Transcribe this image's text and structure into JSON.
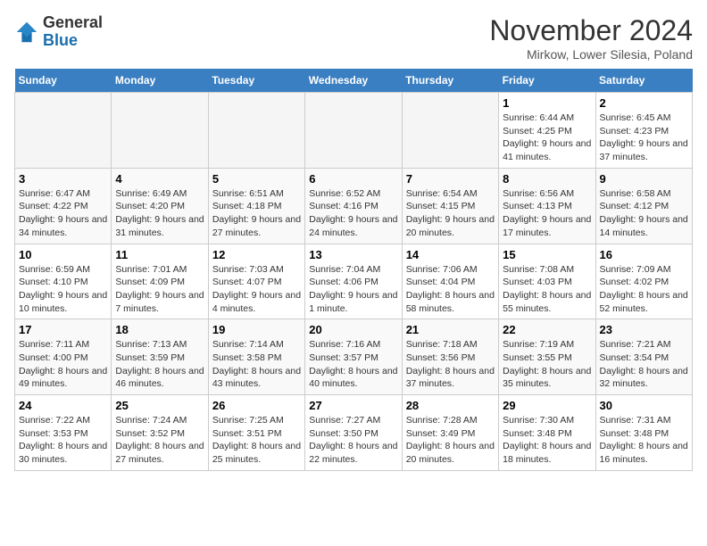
{
  "header": {
    "logo_general": "General",
    "logo_blue": "Blue",
    "month": "November 2024",
    "location": "Mirkow, Lower Silesia, Poland"
  },
  "days_of_week": [
    "Sunday",
    "Monday",
    "Tuesday",
    "Wednesday",
    "Thursday",
    "Friday",
    "Saturday"
  ],
  "weeks": [
    [
      {
        "day": "",
        "info": ""
      },
      {
        "day": "",
        "info": ""
      },
      {
        "day": "",
        "info": ""
      },
      {
        "day": "",
        "info": ""
      },
      {
        "day": "",
        "info": ""
      },
      {
        "day": "1",
        "info": "Sunrise: 6:44 AM\nSunset: 4:25 PM\nDaylight: 9 hours and 41 minutes."
      },
      {
        "day": "2",
        "info": "Sunrise: 6:45 AM\nSunset: 4:23 PM\nDaylight: 9 hours and 37 minutes."
      }
    ],
    [
      {
        "day": "3",
        "info": "Sunrise: 6:47 AM\nSunset: 4:22 PM\nDaylight: 9 hours and 34 minutes."
      },
      {
        "day": "4",
        "info": "Sunrise: 6:49 AM\nSunset: 4:20 PM\nDaylight: 9 hours and 31 minutes."
      },
      {
        "day": "5",
        "info": "Sunrise: 6:51 AM\nSunset: 4:18 PM\nDaylight: 9 hours and 27 minutes."
      },
      {
        "day": "6",
        "info": "Sunrise: 6:52 AM\nSunset: 4:16 PM\nDaylight: 9 hours and 24 minutes."
      },
      {
        "day": "7",
        "info": "Sunrise: 6:54 AM\nSunset: 4:15 PM\nDaylight: 9 hours and 20 minutes."
      },
      {
        "day": "8",
        "info": "Sunrise: 6:56 AM\nSunset: 4:13 PM\nDaylight: 9 hours and 17 minutes."
      },
      {
        "day": "9",
        "info": "Sunrise: 6:58 AM\nSunset: 4:12 PM\nDaylight: 9 hours and 14 minutes."
      }
    ],
    [
      {
        "day": "10",
        "info": "Sunrise: 6:59 AM\nSunset: 4:10 PM\nDaylight: 9 hours and 10 minutes."
      },
      {
        "day": "11",
        "info": "Sunrise: 7:01 AM\nSunset: 4:09 PM\nDaylight: 9 hours and 7 minutes."
      },
      {
        "day": "12",
        "info": "Sunrise: 7:03 AM\nSunset: 4:07 PM\nDaylight: 9 hours and 4 minutes."
      },
      {
        "day": "13",
        "info": "Sunrise: 7:04 AM\nSunset: 4:06 PM\nDaylight: 9 hours and 1 minute."
      },
      {
        "day": "14",
        "info": "Sunrise: 7:06 AM\nSunset: 4:04 PM\nDaylight: 8 hours and 58 minutes."
      },
      {
        "day": "15",
        "info": "Sunrise: 7:08 AM\nSunset: 4:03 PM\nDaylight: 8 hours and 55 minutes."
      },
      {
        "day": "16",
        "info": "Sunrise: 7:09 AM\nSunset: 4:02 PM\nDaylight: 8 hours and 52 minutes."
      }
    ],
    [
      {
        "day": "17",
        "info": "Sunrise: 7:11 AM\nSunset: 4:00 PM\nDaylight: 8 hours and 49 minutes."
      },
      {
        "day": "18",
        "info": "Sunrise: 7:13 AM\nSunset: 3:59 PM\nDaylight: 8 hours and 46 minutes."
      },
      {
        "day": "19",
        "info": "Sunrise: 7:14 AM\nSunset: 3:58 PM\nDaylight: 8 hours and 43 minutes."
      },
      {
        "day": "20",
        "info": "Sunrise: 7:16 AM\nSunset: 3:57 PM\nDaylight: 8 hours and 40 minutes."
      },
      {
        "day": "21",
        "info": "Sunrise: 7:18 AM\nSunset: 3:56 PM\nDaylight: 8 hours and 37 minutes."
      },
      {
        "day": "22",
        "info": "Sunrise: 7:19 AM\nSunset: 3:55 PM\nDaylight: 8 hours and 35 minutes."
      },
      {
        "day": "23",
        "info": "Sunrise: 7:21 AM\nSunset: 3:54 PM\nDaylight: 8 hours and 32 minutes."
      }
    ],
    [
      {
        "day": "24",
        "info": "Sunrise: 7:22 AM\nSunset: 3:53 PM\nDaylight: 8 hours and 30 minutes."
      },
      {
        "day": "25",
        "info": "Sunrise: 7:24 AM\nSunset: 3:52 PM\nDaylight: 8 hours and 27 minutes."
      },
      {
        "day": "26",
        "info": "Sunrise: 7:25 AM\nSunset: 3:51 PM\nDaylight: 8 hours and 25 minutes."
      },
      {
        "day": "27",
        "info": "Sunrise: 7:27 AM\nSunset: 3:50 PM\nDaylight: 8 hours and 22 minutes."
      },
      {
        "day": "28",
        "info": "Sunrise: 7:28 AM\nSunset: 3:49 PM\nDaylight: 8 hours and 20 minutes."
      },
      {
        "day": "29",
        "info": "Sunrise: 7:30 AM\nSunset: 3:48 PM\nDaylight: 8 hours and 18 minutes."
      },
      {
        "day": "30",
        "info": "Sunrise: 7:31 AM\nSunset: 3:48 PM\nDaylight: 8 hours and 16 minutes."
      }
    ]
  ]
}
